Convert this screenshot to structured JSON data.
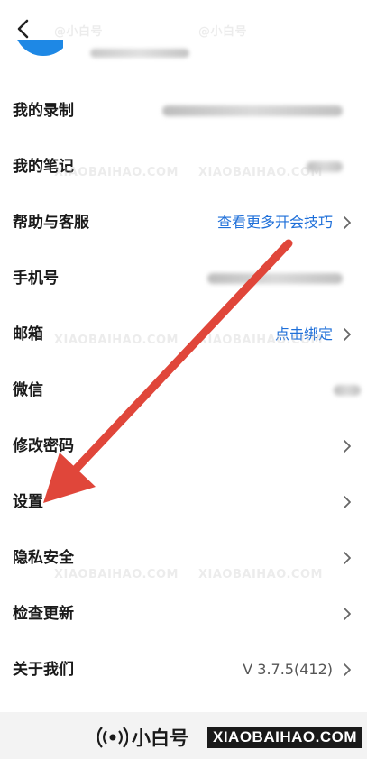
{
  "header": {
    "back_icon": "chevron-left-icon"
  },
  "rows": [
    {
      "label": "我的录制",
      "value": "",
      "has_chevron": false
    },
    {
      "label": "我的笔记",
      "value": "",
      "has_chevron": false
    },
    {
      "label": "帮助与客服",
      "value": "查看更多开会技巧",
      "has_chevron": true
    },
    {
      "label": "手机号",
      "value": "",
      "has_chevron": false
    },
    {
      "label": "邮箱",
      "value": "点击绑定",
      "has_chevron": true
    },
    {
      "label": "微信",
      "value": "",
      "has_chevron": false
    },
    {
      "label": "修改密码",
      "value": "",
      "has_chevron": true
    },
    {
      "label": "设置",
      "value": "",
      "has_chevron": true
    },
    {
      "label": "隐私安全",
      "value": "",
      "has_chevron": true
    },
    {
      "label": "检查更新",
      "value": "",
      "has_chevron": true
    },
    {
      "label": "关于我们",
      "value": "V 3.7.5(412)",
      "has_chevron": true
    }
  ],
  "watermark": {
    "brand_cn": "@小白号",
    "brand_en": "XIAOBAIHAO.COM"
  },
  "footer": {
    "name": "小白号",
    "site": "XIAOBAIHAO.COM"
  },
  "colors": {
    "link": "#1e6fd9",
    "arrow": "#e0463a",
    "avatar": "#1e88e5"
  }
}
